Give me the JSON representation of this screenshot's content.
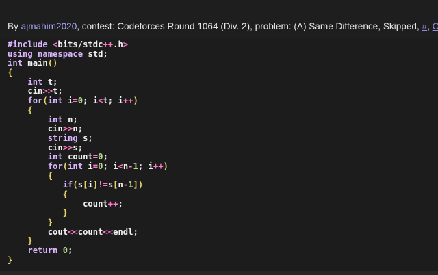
{
  "header": {
    "by_label": "By ",
    "author": "ajmahim2020",
    "contest_label": ", contest: ",
    "contest": "Codeforces Round 1064 (Div. 2)",
    "problem_label": ", problem: ",
    "problem": "(A) Same Difference",
    "verdict_sep": ", ",
    "verdict": "Skipped",
    "link_sep": ", ",
    "hash_link": "#",
    "copy_sep": ", ",
    "copy_link": "Copy"
  },
  "code": {
    "language": "cpp",
    "lines": [
      [
        [
          "pp",
          "#include "
        ],
        [
          "op",
          "<"
        ],
        [
          "pl",
          "bits/stdc"
        ],
        [
          "op",
          "++"
        ],
        [
          "pl",
          ".h"
        ],
        [
          "op",
          ">"
        ]
      ],
      [
        [
          "kw",
          "using"
        ],
        [
          "sp",
          " "
        ],
        [
          "kw",
          "namespace"
        ],
        [
          "sp",
          " "
        ],
        [
          "pl",
          "std;"
        ]
      ],
      [
        [
          "kw",
          "int"
        ],
        [
          "sp",
          " "
        ],
        [
          "pl",
          "main"
        ],
        [
          "br",
          "()"
        ]
      ],
      [
        [
          "br",
          "{"
        ]
      ],
      [
        [
          "sp",
          "    "
        ],
        [
          "kw",
          "int"
        ],
        [
          "sp",
          " "
        ],
        [
          "pl",
          "t;"
        ]
      ],
      [
        [
          "sp",
          "    "
        ],
        [
          "pl",
          "cin"
        ],
        [
          "op",
          ">>"
        ],
        [
          "pl",
          "t;"
        ]
      ],
      [
        [
          "sp",
          "    "
        ],
        [
          "kw",
          "for"
        ],
        [
          "br",
          "("
        ],
        [
          "kw",
          "int"
        ],
        [
          "sp",
          " "
        ],
        [
          "pl",
          "i"
        ],
        [
          "op",
          "="
        ],
        [
          "num",
          "0"
        ],
        [
          "pl",
          "; i"
        ],
        [
          "op",
          "<"
        ],
        [
          "pl",
          "t; i"
        ],
        [
          "op",
          "++"
        ],
        [
          "br",
          ")"
        ]
      ],
      [
        [
          "sp",
          "    "
        ],
        [
          "br",
          "{"
        ]
      ],
      [
        [
          "sp",
          "        "
        ],
        [
          "kw",
          "int"
        ],
        [
          "sp",
          " "
        ],
        [
          "pl",
          "n;"
        ]
      ],
      [
        [
          "sp",
          "        "
        ],
        [
          "pl",
          "cin"
        ],
        [
          "op",
          ">>"
        ],
        [
          "pl",
          "n;"
        ]
      ],
      [
        [
          "sp",
          "        "
        ],
        [
          "kw",
          "string"
        ],
        [
          "sp",
          " "
        ],
        [
          "pl",
          "s;"
        ]
      ],
      [
        [
          "sp",
          "        "
        ],
        [
          "pl",
          "cin"
        ],
        [
          "op",
          ">>"
        ],
        [
          "pl",
          "s;"
        ]
      ],
      [
        [
          "sp",
          "        "
        ],
        [
          "kw",
          "int"
        ],
        [
          "sp",
          " "
        ],
        [
          "pl",
          "count"
        ],
        [
          "op",
          "="
        ],
        [
          "num",
          "0"
        ],
        [
          "pl",
          ";"
        ]
      ],
      [
        [
          "sp",
          "        "
        ],
        [
          "kw",
          "for"
        ],
        [
          "br",
          "("
        ],
        [
          "kw",
          "int"
        ],
        [
          "sp",
          " "
        ],
        [
          "pl",
          "i"
        ],
        [
          "op",
          "="
        ],
        [
          "num",
          "0"
        ],
        [
          "pl",
          "; i"
        ],
        [
          "op",
          "<"
        ],
        [
          "pl",
          "n"
        ],
        [
          "op",
          "-"
        ],
        [
          "num",
          "1"
        ],
        [
          "pl",
          "; i"
        ],
        [
          "op",
          "++"
        ],
        [
          "br",
          ")"
        ]
      ],
      [
        [
          "sp",
          "        "
        ],
        [
          "br",
          "{"
        ]
      ],
      [
        [
          "sp",
          "           "
        ],
        [
          "kw",
          "if"
        ],
        [
          "br",
          "("
        ],
        [
          "pl",
          "s"
        ],
        [
          "br",
          "["
        ],
        [
          "pl",
          "i"
        ],
        [
          "br",
          "]"
        ],
        [
          "op",
          "!="
        ],
        [
          "pl",
          "s"
        ],
        [
          "br",
          "["
        ],
        [
          "pl",
          "n"
        ],
        [
          "op",
          "-"
        ],
        [
          "num",
          "1"
        ],
        [
          "br",
          "])"
        ]
      ],
      [
        [
          "sp",
          "           "
        ],
        [
          "br",
          "{"
        ]
      ],
      [
        [
          "sp",
          "               "
        ],
        [
          "pl",
          "count"
        ],
        [
          "op",
          "++"
        ],
        [
          "pl",
          ";"
        ]
      ],
      [
        [
          "sp",
          "           "
        ],
        [
          "br",
          "}"
        ]
      ],
      [
        [
          "sp",
          "        "
        ],
        [
          "br",
          "}"
        ]
      ],
      [
        [
          "sp",
          "        "
        ],
        [
          "pl",
          "cout"
        ],
        [
          "op",
          "<<"
        ],
        [
          "pl",
          "count"
        ],
        [
          "op",
          "<<"
        ],
        [
          "pl",
          "endl;"
        ]
      ],
      [
        [
          "sp",
          "    "
        ],
        [
          "br",
          "}"
        ]
      ],
      [
        [
          "sp",
          "    "
        ],
        [
          "kw",
          "return"
        ],
        [
          "sp",
          " "
        ],
        [
          "num",
          "0"
        ],
        [
          "pl",
          ";"
        ]
      ],
      [
        [
          "br",
          "}"
        ]
      ]
    ]
  }
}
